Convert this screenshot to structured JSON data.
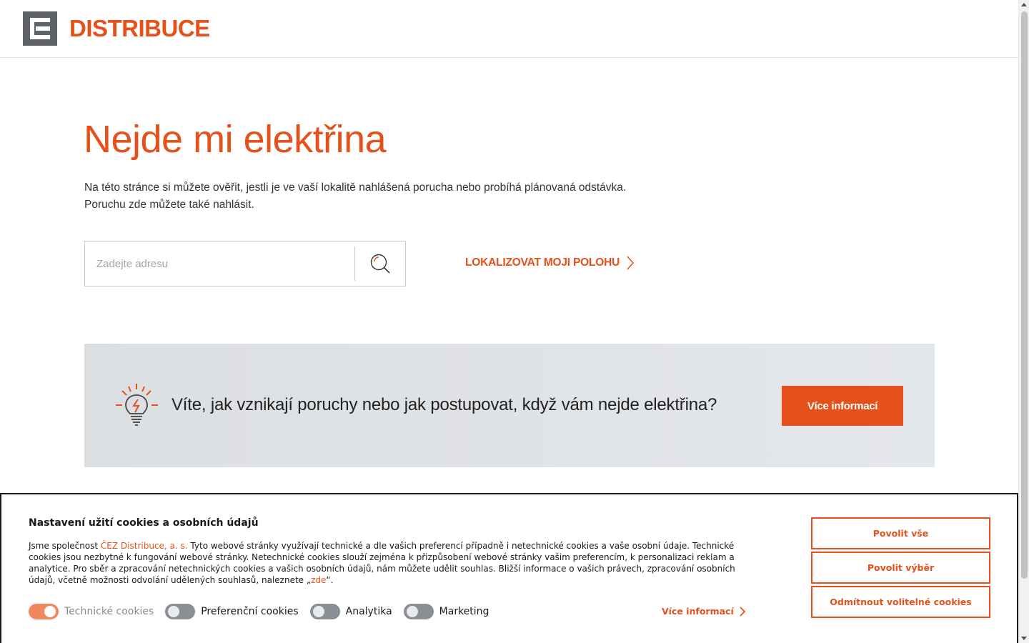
{
  "brand": {
    "name": "DISTRIBUCE",
    "accent_color": "#e5501b",
    "logo_icon": "cez-logo-icon"
  },
  "main": {
    "title": "Nejde mi elektřina",
    "intro_line1": "Na této stránce si můžete ověřit, jestli je ve vaší lokalitě nahlášená porucha nebo probíhá plánovaná odstávka.",
    "intro_line2": "Poruchu zde můžete také nahlásit.",
    "search": {
      "placeholder": "Zadejte adresu",
      "value": "",
      "icon": "search-icon"
    },
    "locate_label": "LOKALIZOVAT MOJI POLOHU"
  },
  "banner": {
    "icon": "lightbulb-icon",
    "text": "Víte, jak vznikají poruchy nebo jak postupovat, když vám nejde elektřina?",
    "button_label": "Více informací"
  },
  "cookies": {
    "title": "Nastavení užití cookies a osobních údajů",
    "text_prefix": "Jsme společnost ",
    "company_link": "ČEZ Distribuce, a. s.",
    "text_body": " Tyto webové stránky využívají technické a dle vašich preferencí případně i netechnické cookies a vaše osobní údaje. Technické cookies jsou nezbytné k fungování webové stránky. Netechnické cookies slouží zejména k přizpůsobení webové stránky vašim preferencím, k personalizaci reklam a analytice. Pro sběr a zpracování netechnických cookies a vašich osobních údajů, nám můžete udělit souhlas. Bližší informace o vašich právech, zpracování osobních údajů, včetně možnosti odvolání udělených souhlasů, naleznete „",
    "here_link": "zde",
    "text_suffix": "“.",
    "toggles": [
      {
        "label": "Technické cookies",
        "on": true,
        "disabled": true
      },
      {
        "label": "Preferenční cookies",
        "on": false,
        "disabled": false
      },
      {
        "label": "Analytika",
        "on": false,
        "disabled": false
      },
      {
        "label": "Marketing",
        "on": false,
        "disabled": false
      }
    ],
    "more_label": "Více informací",
    "buttons": {
      "allow_all": "Povolit vše",
      "allow_selection": "Povolit výběr",
      "reject_optional": "Odmítnout volitelné cookies"
    }
  }
}
